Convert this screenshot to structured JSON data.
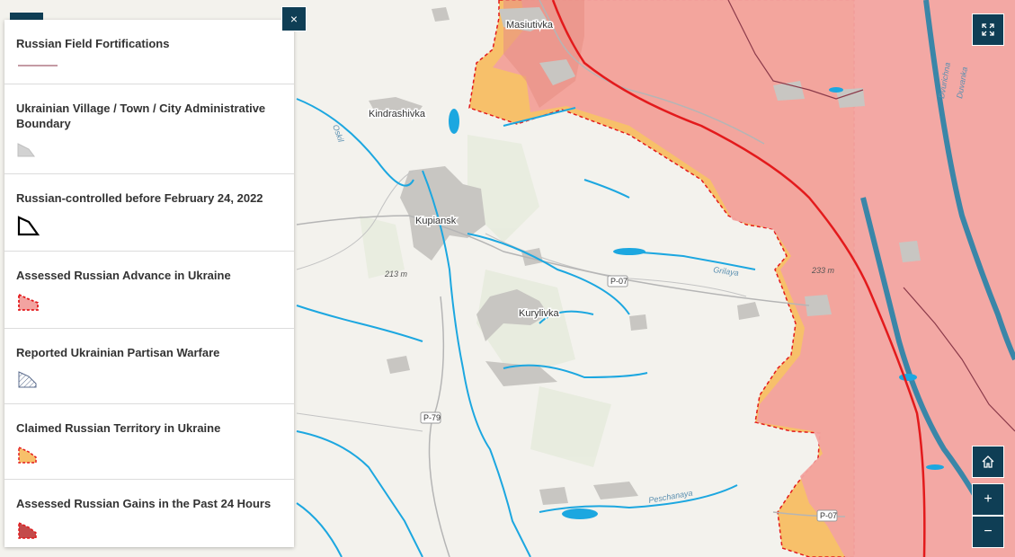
{
  "map": {
    "places": [
      "Masiutivka",
      "Kindrashivka",
      "Kupiansk",
      "Kurylivka"
    ],
    "elevations": [
      "213 m",
      "233 m"
    ],
    "rivers": [
      "Grilaya",
      "Peschanaya",
      "Oskil",
      "Dvurichna",
      "Duvanka"
    ],
    "roads": [
      "P-07",
      "P-79",
      "P-07"
    ]
  },
  "legend": {
    "items": [
      {
        "label": "Russian Field Fortifications",
        "symbol": "line-icon"
      },
      {
        "label": "Ukrainian Village / Town / City Administrative Boundary",
        "symbol": "grey-polygon-icon"
      },
      {
        "label": "Russian-controlled before February 24, 2022",
        "symbol": "black-outline-polygon-icon"
      },
      {
        "label": "Assessed Russian Advance in Ukraine",
        "symbol": "red-dashed-polygon-icon"
      },
      {
        "label": "Reported Ukrainian Partisan Warfare",
        "symbol": "hatched-polygon-icon"
      },
      {
        "label": "Claimed Russian Territory in Ukraine",
        "symbol": "orange-dashed-polygon-icon"
      },
      {
        "label": "Assessed Russian Gains in the Past 24 Hours",
        "symbol": "dark-red-polygon-icon"
      }
    ]
  },
  "controls": {
    "close": "×",
    "zoom_in": "+",
    "zoom_out": "−"
  },
  "colors": {
    "panel_dark": "#0f3e55",
    "russian_advance": "#f2a3a0",
    "claimed_territory": "#f7c06a",
    "border_line": "#e31a1c",
    "water": "#1ca7e0"
  }
}
